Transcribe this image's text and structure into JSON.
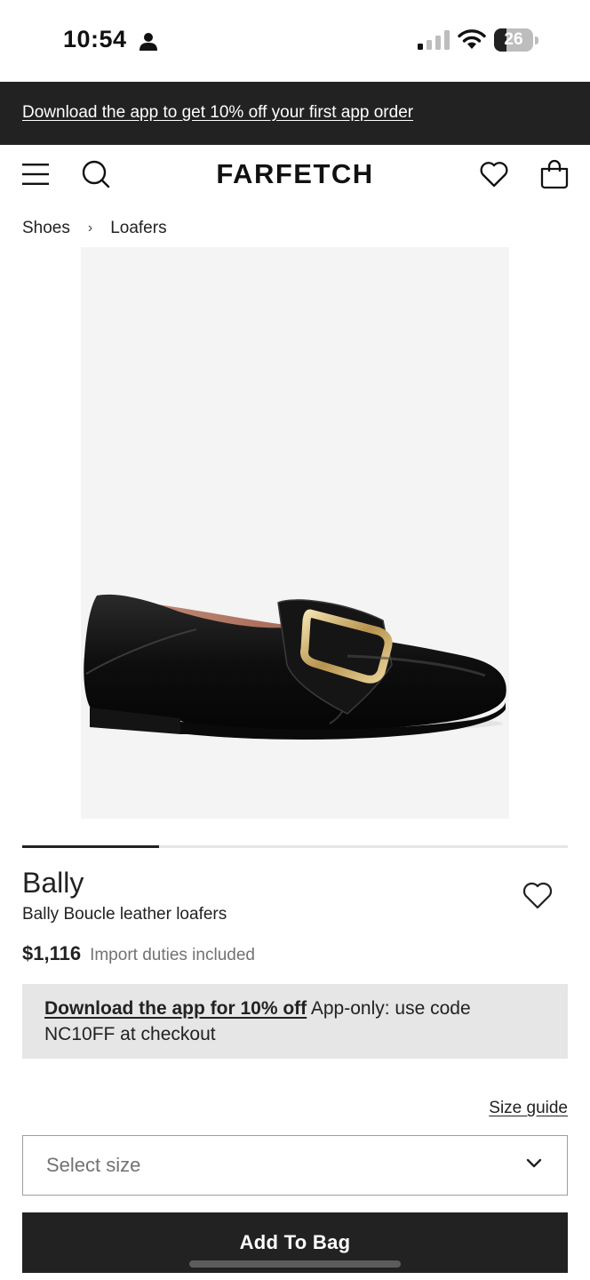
{
  "status_bar": {
    "time": "10:54",
    "battery_level": "26"
  },
  "promo_banner": {
    "text": "Download the app to get 10% off your first app order"
  },
  "header": {
    "logo": "FARFETCH",
    "icons": [
      "menu-icon",
      "search-icon",
      "heart-icon",
      "shopping-bag-icon"
    ]
  },
  "breadcrumb": {
    "items": [
      "Shoes",
      "Loafers"
    ],
    "separator": "›"
  },
  "gallery": {
    "progress_fraction": 0.25
  },
  "product": {
    "brand": "Bally",
    "description": "Bally Boucle leather loafers",
    "price": "$1,116",
    "duties_note": "Import duties included"
  },
  "app_offer": {
    "link_text": "Download the app for 10% off",
    "body_text": " App-only: use code NC10FF at checkout"
  },
  "size": {
    "guide_label": "Size guide",
    "select_placeholder": "Select size"
  },
  "actions": {
    "add_to_bag": "Add To Bag"
  },
  "colors": {
    "banner_bg": "#222222",
    "button_bg": "#222222",
    "offer_bg": "#e6e6e6",
    "image_bg": "#f4f4f4"
  }
}
